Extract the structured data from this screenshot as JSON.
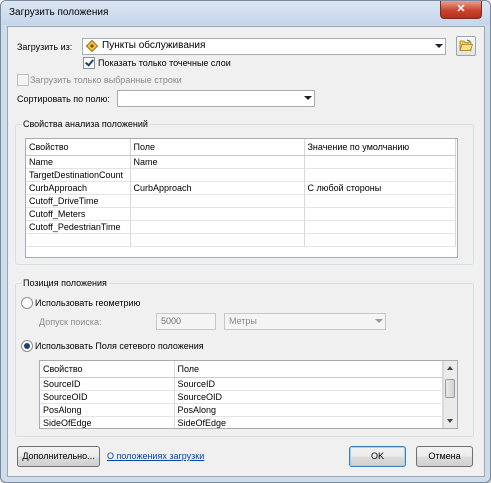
{
  "window": {
    "title": "Загрузить положения",
    "close_symbol": "✕"
  },
  "load_from": {
    "label": "Загрузить из:",
    "value": "Пункты обслуживания"
  },
  "show_point_layers": {
    "label": "Показать только точечные слои",
    "checked": true
  },
  "load_selected_only": {
    "label": "Загрузить только выбранные строки",
    "checked": false,
    "enabled": false
  },
  "sort_by": {
    "label": "Сортировать по полю:",
    "value": ""
  },
  "properties": {
    "group_title": "Свойства анализа положений",
    "columns": [
      "Свойство",
      "Поле",
      "Значение по умолчанию"
    ],
    "rows": [
      [
        "Name",
        "Name",
        ""
      ],
      [
        "TargetDestinationCount",
        "",
        ""
      ],
      [
        "CurbApproach",
        "CurbApproach",
        "С любой стороны"
      ],
      [
        "Cutoff_DriveTime",
        "",
        ""
      ],
      [
        "Cutoff_Meters",
        "",
        ""
      ],
      [
        "Cutoff_PedestrianTime",
        "",
        ""
      ],
      [
        "",
        "",
        ""
      ]
    ]
  },
  "location": {
    "group_title": "Позиция положения",
    "use_geometry": {
      "label": "Использовать геометрию",
      "selected": false
    },
    "tolerance": {
      "label": "Допуск поиска:",
      "value": "5000",
      "unit": "Метры"
    },
    "use_network_fields": {
      "label": "Использовать Поля сетевого положения",
      "selected": true
    },
    "fields": {
      "columns": [
        "Свойство",
        "Поле"
      ],
      "rows": [
        [
          "SourceID",
          "SourceID"
        ],
        [
          "SourceOID",
          "SourceOID"
        ],
        [
          "PosAlong",
          "PosAlong"
        ],
        [
          "SideOfEdge",
          "SideOfEdge"
        ]
      ]
    }
  },
  "footer": {
    "advanced_label": "Дополнительно...",
    "help_link": "О положениях загрузки",
    "ok_label": "OK",
    "cancel_label": "Отмена"
  },
  "colors": {
    "title_bar": "#c5d6ea",
    "close_button": "#c9432f",
    "link": "#0645ad"
  }
}
